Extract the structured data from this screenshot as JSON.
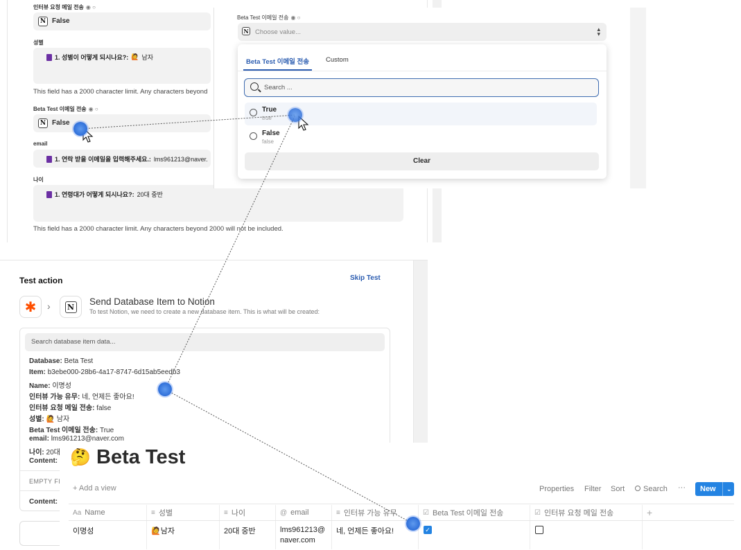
{
  "form": {
    "fields": [
      {
        "label": "인터뷰 요청 메일 전송",
        "radio": "◉ ○",
        "value": "False"
      },
      {
        "label": "성별",
        "pill_bold": "1. 성별이 어떻게 되시나요?:",
        "pill_emoji": "🙋",
        "pill_value": "남자"
      },
      {
        "label": "Beta Test 이메일 전송",
        "radio": "◉ ○",
        "value": "False"
      },
      {
        "label": "email",
        "pill_bold": "1. 연락 받을 이메일을 입력해주세요.:",
        "pill_value": "lms961213@naver."
      },
      {
        "label": "나이",
        "pill_bold": "1. 연령대가 어떻게 되시나요?:",
        "pill_value": "20대 중반"
      }
    ],
    "char_limit_note_1": "This field has a 2000 character limit. Any characters beyond",
    "char_limit_note_2": "This field has a 2000 character limit. Any characters beyond 2000 will not be included."
  },
  "dropdown": {
    "field_label": "Beta Test 이메일 전송",
    "radio": "◉ ○",
    "placeholder": "Choose value...",
    "tabs": [
      "Beta Test 이메일 전송",
      "Custom"
    ],
    "search_placeholder": "Search ...",
    "options": [
      {
        "label": "True",
        "sub": "true"
      },
      {
        "label": "False",
        "sub": "false"
      }
    ],
    "clear_label": "Clear"
  },
  "test_action": {
    "heading": "Test action",
    "skip_label": "Skip Test",
    "title": "Send Database Item to Notion",
    "subtitle": "To test Notion, we need to create a new database item. This is what will be created:",
    "search_placeholder": "Search database item data...",
    "lines": [
      {
        "key": "Database:",
        "value": "Beta Test"
      },
      {
        "key": "Item:",
        "value": "b3ebe000-28b6-4a17-8747-6d15ab5eedb3"
      },
      {
        "key": "Name:",
        "value": "이명성"
      },
      {
        "key": "인터뷰 가능 유무:",
        "value": "네, 언제든 좋아요!"
      },
      {
        "key": "인터뷰 요청 메일 전송:",
        "value": "false"
      },
      {
        "key": "성별:",
        "value": "🙋 남자"
      },
      {
        "key": "Beta Test 이메일 전송:",
        "value": "True"
      },
      {
        "key": "email:",
        "value": "lms961213@naver.com"
      },
      {
        "key": "나이:",
        "value": "20대"
      },
      {
        "key": "Content:",
        "value": ""
      }
    ],
    "empty_label": "EMPTY FI",
    "content_label": "Content:"
  },
  "notion": {
    "emoji": "🤔",
    "title": "Beta Test",
    "add_view": "+ Add a view",
    "toolbar": {
      "properties": "Properties",
      "filter": "Filter",
      "sort": "Sort",
      "search": "Search",
      "more": "···",
      "new": "New"
    },
    "columns": [
      {
        "icon": "Aa",
        "name": "Name"
      },
      {
        "icon": "≡",
        "name": "성별"
      },
      {
        "icon": "≡",
        "name": "나이"
      },
      {
        "icon": "@",
        "name": "email"
      },
      {
        "icon": "≡",
        "name": "인터뷰 가능 유무"
      },
      {
        "icon": "☑",
        "name": "Beta Test 이메일 전송"
      },
      {
        "icon": "☑",
        "name": "인터뷰 요청 메일 전송"
      }
    ],
    "add_column": "+",
    "row": {
      "name": "이명성",
      "gender_emoji": "🙋",
      "gender": "남자",
      "age": "20대 중반",
      "email_1": "lms961213@",
      "email_2": "naver.com",
      "interview": "네, 언제든 좋아요!",
      "beta_checked": true,
      "interview_mail_checked": false
    },
    "colors": {
      "new_button": "#2383e2",
      "checkbox": "#2383e2"
    }
  }
}
